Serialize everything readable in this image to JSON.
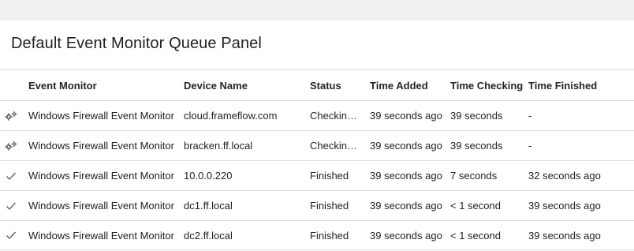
{
  "panel": {
    "title": "Default Event Monitor Queue Panel"
  },
  "table": {
    "columns": {
      "event_monitor": "Event Monitor",
      "device_name": "Device Name",
      "status": "Status",
      "time_added": "Time Added",
      "time_checking": "Time Checking",
      "time_finished": "Time Finished"
    },
    "rows": [
      {
        "icon": "gears-icon",
        "event_monitor": "Windows Firewall Event Monitor",
        "device_name": "cloud.frameflow.com",
        "status": "Checking…",
        "time_added": "39 seconds ago",
        "time_checking": "39 seconds",
        "time_finished": "-"
      },
      {
        "icon": "gears-icon",
        "event_monitor": "Windows Firewall Event Monitor",
        "device_name": "bracken.ff.local",
        "status": "Checking…",
        "time_added": "39 seconds ago",
        "time_checking": "39 seconds",
        "time_finished": "-"
      },
      {
        "icon": "checkmark-icon",
        "event_monitor": "Windows Firewall Event Monitor",
        "device_name": "10.0.0.220",
        "status": "Finished",
        "time_added": "39 seconds ago",
        "time_checking": "7 seconds",
        "time_finished": "32 seconds ago"
      },
      {
        "icon": "checkmark-icon",
        "event_monitor": "Windows Firewall Event Monitor",
        "device_name": "dc1.ff.local",
        "status": "Finished",
        "time_added": "39 seconds ago",
        "time_checking": "< 1 second",
        "time_finished": "39 seconds ago"
      },
      {
        "icon": "checkmark-icon",
        "event_monitor": "Windows Firewall Event Monitor",
        "device_name": "dc2.ff.local",
        "status": "Finished",
        "time_added": "39 seconds ago",
        "time_checking": "< 1 second",
        "time_finished": "39 seconds ago"
      }
    ]
  }
}
